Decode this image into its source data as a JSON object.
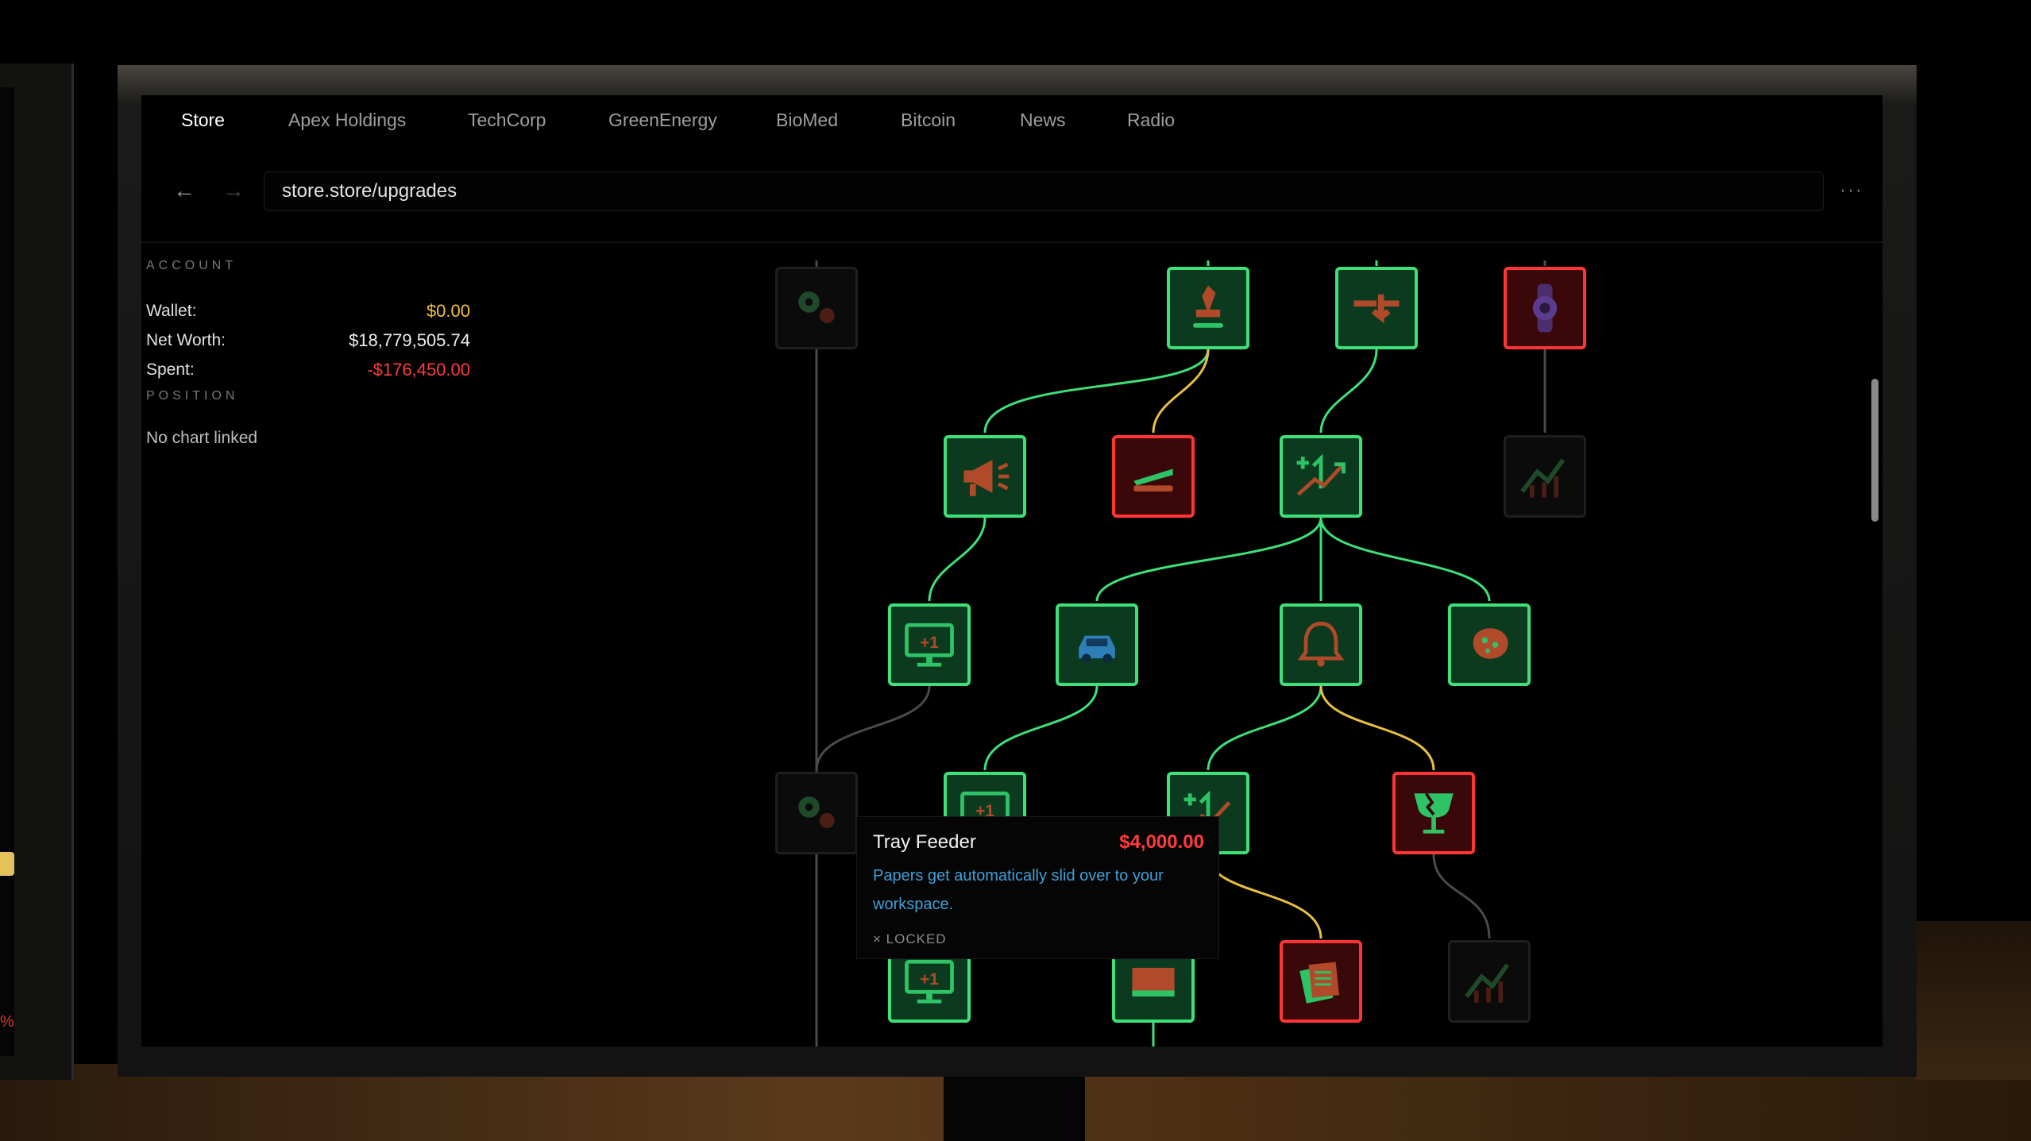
{
  "browser": {
    "tabs": [
      {
        "label": "Store",
        "active": true
      },
      {
        "label": "Apex Holdings",
        "active": false
      },
      {
        "label": "TechCorp",
        "active": false
      },
      {
        "label": "GreenEnergy",
        "active": false
      },
      {
        "label": "BioMed",
        "active": false
      },
      {
        "label": "Bitcoin",
        "active": false
      },
      {
        "label": "News",
        "active": false
      },
      {
        "label": "Radio",
        "active": false
      }
    ],
    "back_icon": "←",
    "forward_icon": "→",
    "url": "store.store/upgrades",
    "menu_icon": "···"
  },
  "sidebar": {
    "account_heading": "ACCOUNT",
    "wallet_label": "Wallet:",
    "wallet_value": "$0.00",
    "net_worth_label": "Net Worth:",
    "net_worth_value": "$18,779,505.74",
    "spent_label": "Spent:",
    "spent_value": "-$176,450.00",
    "position_heading": "POSITION",
    "position_text": "No chart linked"
  },
  "upgrade_tree": {
    "nodes": [
      {
        "id": "gears-top",
        "icon": "gears-icon",
        "state": "unavailable"
      },
      {
        "id": "stamp",
        "icon": "stamp-icon",
        "state": "owned"
      },
      {
        "id": "arrow-split",
        "icon": "arrow-split-icon",
        "state": "owned"
      },
      {
        "id": "watch",
        "icon": "watch-icon",
        "state": "locked"
      },
      {
        "id": "megaphone",
        "icon": "megaphone-icon",
        "state": "owned"
      },
      {
        "id": "stapler",
        "icon": "stapler-icon",
        "state": "locked"
      },
      {
        "id": "stocks-plus",
        "icon": "stocks-plus-icon",
        "state": "owned"
      },
      {
        "id": "chart-dim-top",
        "icon": "bar-chart-icon",
        "state": "unavailable"
      },
      {
        "id": "monitor-plus-one",
        "icon": "monitor-plus-one-icon",
        "state": "owned"
      },
      {
        "id": "car",
        "icon": "car-icon",
        "state": "owned"
      },
      {
        "id": "bell",
        "icon": "bell-icon",
        "state": "owned"
      },
      {
        "id": "sponge",
        "icon": "sponge-icon",
        "state": "owned"
      },
      {
        "id": "gears-mid",
        "icon": "gears-icon",
        "state": "unavailable"
      },
      {
        "id": "monitor-plus-one-2",
        "icon": "monitor-plus-one-icon",
        "state": "owned"
      },
      {
        "id": "stocks-plus-2",
        "icon": "stocks-plus-icon",
        "state": "owned"
      },
      {
        "id": "broken-glass",
        "icon": "broken-glass-icon",
        "state": "locked"
      },
      {
        "id": "monitor-plus-one-3",
        "icon": "monitor-plus-one-icon",
        "state": "owned"
      },
      {
        "id": "tray",
        "icon": "tray-icon",
        "state": "owned"
      },
      {
        "id": "papers",
        "icon": "papers-icon",
        "state": "locked"
      },
      {
        "id": "chart-dim-bottom",
        "icon": "bar-chart-icon",
        "state": "unavailable"
      }
    ]
  },
  "tooltip": {
    "name": "Tray Feeder",
    "price": "$4,000.00",
    "description": "Papers get automatically slid over to your workspace.",
    "status_icon": "×",
    "status": "LOCKED"
  },
  "colors": {
    "owned_border": "#3ee07a",
    "locked_border": "#ff3535",
    "wallet": "#f0c040",
    "spent": "#ff3b3b",
    "price": "#ff3b3b",
    "description": "#3fa0d8",
    "connector_green": "#3ee07a",
    "connector_yellow": "#e8c040",
    "connector_gray": "#4a4a4a"
  }
}
